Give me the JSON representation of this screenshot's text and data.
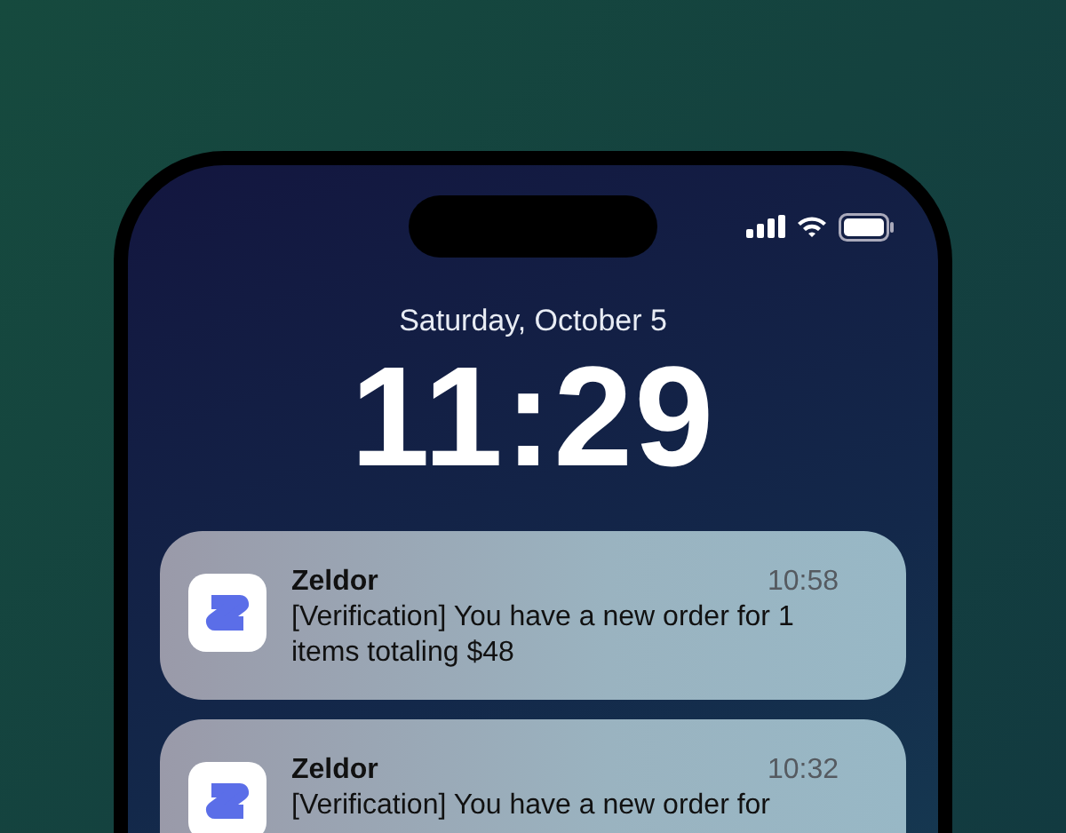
{
  "status_bar": {
    "date": "Saturday, October 5",
    "time": "11:29"
  },
  "notifications": [
    {
      "app": "Zeldor",
      "time": "10:58",
      "message": "[Verification] You have a new order for 1 items totaling $48"
    },
    {
      "app": "Zeldor",
      "time": "10:32",
      "message": "[Verification] You have a new order for"
    }
  ]
}
